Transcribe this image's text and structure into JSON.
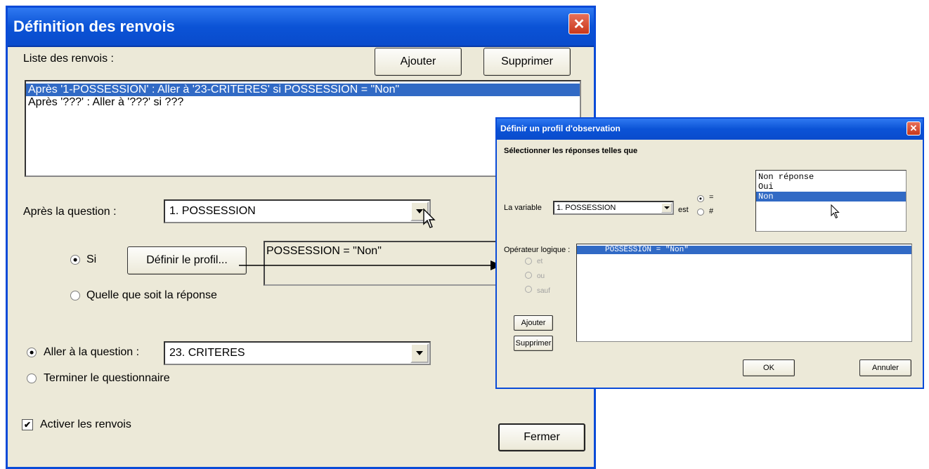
{
  "main_dialog": {
    "title": "Définition des renvois",
    "close_glyph": "✕",
    "list_label": "Liste des renvois :",
    "add_button": "Ajouter",
    "delete_button": "Supprimer",
    "rules": [
      "Après '1-POSSESSION' : Aller à '23-CRITERES'  si POSSESSION = \"Non\"",
      "Après '???' : Aller à '???'  si  ???"
    ],
    "after_question_label": "Après la question :",
    "after_question_value": "1. POSSESSION",
    "si_label": "Si",
    "define_profile_button": "Définir le profil...",
    "profile_expression": "POSSESSION = \"Non\"",
    "any_answer_label": "Quelle que soit la réponse",
    "goto_question_label": "Aller à la question :",
    "goto_question_value": "23. CRITERES",
    "end_questionnaire_label": "Terminer le questionnaire",
    "activate_label": "Activer les renvois",
    "activate_check": "✔",
    "close_button": "Fermer"
  },
  "profile_dialog": {
    "title": "Définir un profil d'observation",
    "close_glyph": "✕",
    "subtitle": "Sélectionner les réponses telles que",
    "variable_label": "La variable",
    "variable_value": "1. POSSESSION",
    "est_label": "est",
    "equals_label": "=",
    "not_equals_label": "#",
    "answers": [
      "Non réponse",
      "Oui",
      "Non"
    ],
    "logic_operator_label": "Opérateur logique :",
    "op_et": "et",
    "op_ou": "ou",
    "op_sauf": "sauf",
    "expression": "POSSESSION = \"Non\"",
    "add_button": "Ajouter",
    "delete_button": "Supprimer",
    "ok_button": "OK",
    "cancel_button": "Annuler"
  },
  "colors": {
    "title_bar": "#0b53d6",
    "selection": "#316ac5",
    "dialog_bg": "#ece9d8"
  }
}
